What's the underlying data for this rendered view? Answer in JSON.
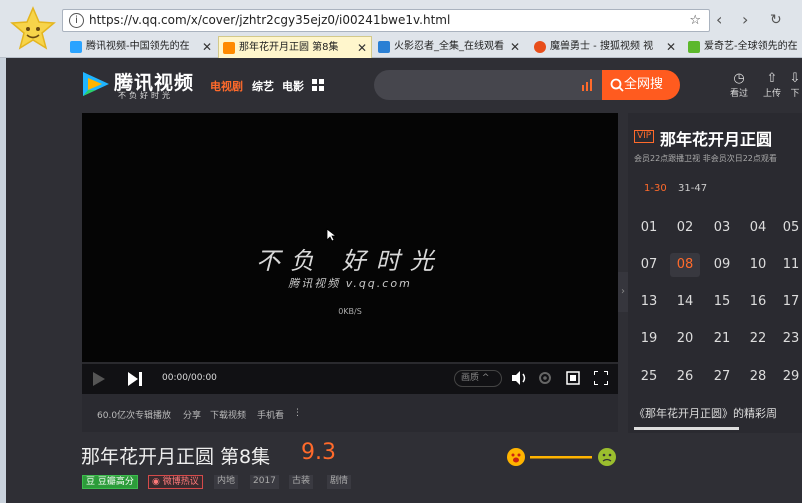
{
  "browser": {
    "url": "https://v.qq.com/x/cover/jzhtr2cgy35ejz0/i00241bwe1v.html",
    "tabs": [
      {
        "label": "腾讯视频-中国领先的在",
        "active": false,
        "color": "#2aa3ff"
      },
      {
        "label": "那年花开月正圆 第8集",
        "active": true,
        "color": "#ff8a00"
      },
      {
        "label": "火影忍者_全集_在线观看",
        "active": false,
        "color": "#2a7fd4"
      },
      {
        "label": "魔兽勇士 - 搜狐视频 视",
        "active": false,
        "color": "#e84e1b"
      },
      {
        "label": "爱奇艺-全球领先的在",
        "active": false,
        "color": "#5cb82c"
      }
    ]
  },
  "header": {
    "brand_name": "腾讯视频",
    "brand_slogan": "不负好时光",
    "nav": [
      {
        "label": "电视剧",
        "active": true
      },
      {
        "label": "综艺",
        "active": false
      },
      {
        "label": "电影",
        "active": false
      }
    ],
    "search_button": "全网搜",
    "tools": [
      {
        "label": "看过",
        "icon": "clock-icon"
      },
      {
        "label": "上传",
        "icon": "upload-icon"
      },
      {
        "label": "下",
        "icon": "download-icon"
      }
    ]
  },
  "player": {
    "watermark_main": "不负 好时光",
    "watermark_sub": "腾讯视频 v.qq.com",
    "speed": "0KB/S",
    "time": "00:00/00:00",
    "quality": "画质"
  },
  "below_player": {
    "plays": "60.0亿次专辑播放",
    "share": "分享",
    "download": "下载视频",
    "mobile": "手机看",
    "more": "⋮"
  },
  "title_block": {
    "title": "那年花开月正圆 第8集",
    "score": "9.3",
    "tags": [
      "豆瓣高分",
      "微博热议",
      "内地",
      "2017",
      "古装",
      "剧情"
    ]
  },
  "panel": {
    "vip": "VIP",
    "title": "那年花开月正圆",
    "schedule": "会员22点跟播卫视 非会员次日22点观看",
    "ranges": [
      "1-30",
      "31-47"
    ],
    "episodes": [
      [
        "01",
        "02",
        "03",
        "04",
        "05"
      ],
      [
        "07",
        "08",
        "09",
        "10",
        "11"
      ],
      [
        "13",
        "14",
        "15",
        "16",
        "17"
      ],
      [
        "19",
        "20",
        "21",
        "22",
        "23"
      ],
      [
        "25",
        "26",
        "27",
        "28",
        "29"
      ]
    ],
    "footer": "《那年花开月正圆》的精彩周"
  }
}
